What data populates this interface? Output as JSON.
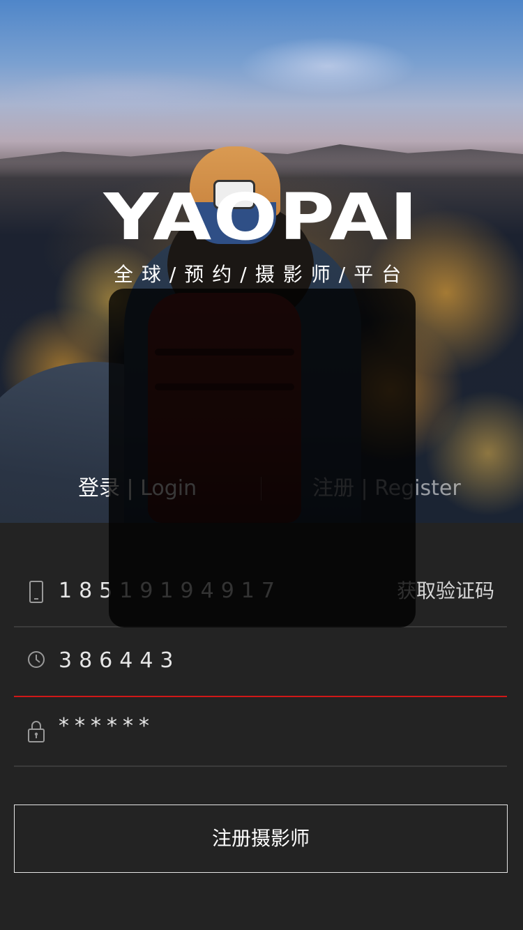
{
  "brand": {
    "logo_text": "YAOPAI",
    "tagline": "全球/预约/摄影师/平台"
  },
  "tabs": {
    "login": "登录 | Login",
    "register": "注册 | Register",
    "active": "login"
  },
  "form": {
    "phone": {
      "value": "18519194917",
      "icon": "phone-icon",
      "get_code_label": "获取验证码"
    },
    "code": {
      "value": "386443",
      "icon": "clock-icon"
    },
    "password": {
      "value": "******",
      "icon": "lock-icon"
    },
    "submit_label": "注册摄影师"
  },
  "colors": {
    "background": "#232323",
    "focus_underline": "#d01818",
    "divider": "#3b3b3b"
  }
}
